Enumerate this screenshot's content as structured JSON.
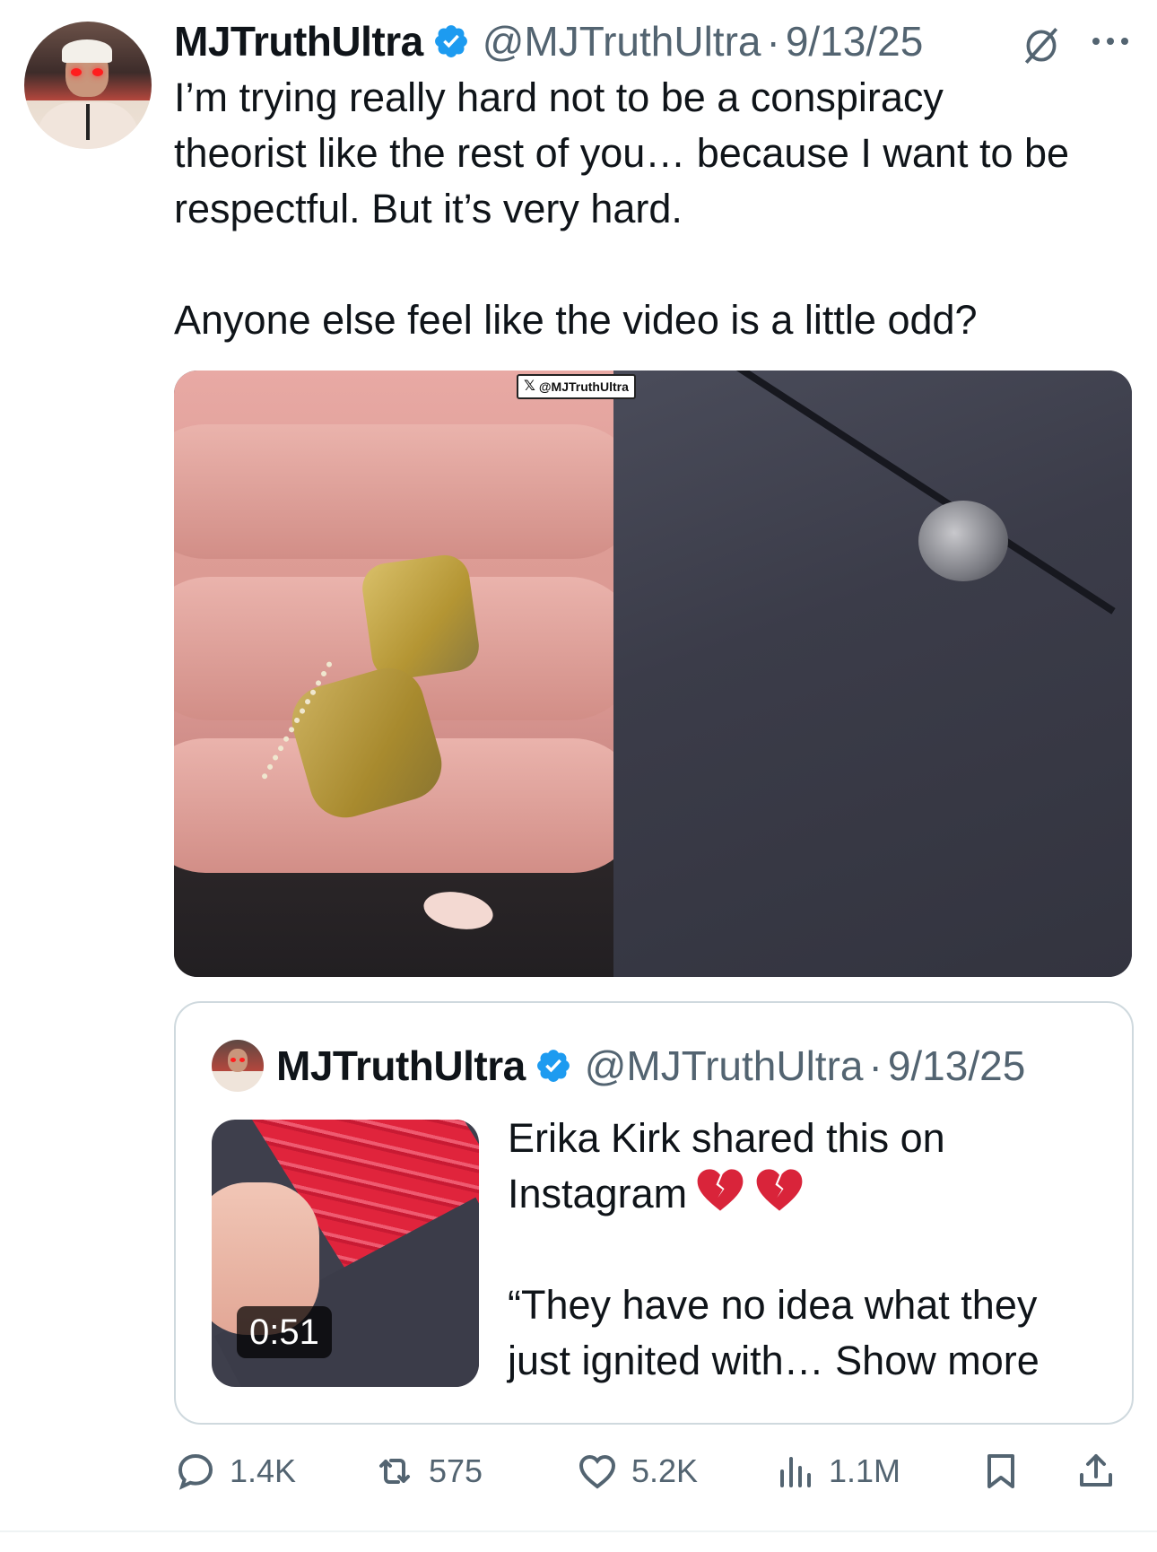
{
  "tweet": {
    "author_name": "MJTruthUltra",
    "handle": "@MJTruthUltra",
    "separator": "·",
    "date": "9/13/25",
    "text": "I’m trying really hard not to be a conspiracy\ntheorist like the rest of you… because I want to be\nrespectful. But it’s very hard.\n\nAnyone else feel like the video is a little odd?",
    "media_watermark": "@MJTruthUltra"
  },
  "quoted": {
    "author_name": "MJTruthUltra",
    "handle": "@MJTruthUltra",
    "separator": "·",
    "date": "9/13/25",
    "text_line1": "Erika Kirk shared this on\nInstagram",
    "emoji": "💔💔",
    "text_line2": "“They have no idea what they\njust ignited with… ",
    "show_more": "Show more",
    "video_duration": "0:51"
  },
  "actions": {
    "replies": "1.4K",
    "reposts": "575",
    "likes": "5.2K",
    "views": "1.1M"
  },
  "colors": {
    "text": "#0f1419",
    "secondary": "#536471",
    "verified": "#1d9bf0",
    "border": "#cfd9de",
    "heartbreak": "#d9243a"
  },
  "icons": [
    "verified-badge-icon",
    "grok-icon",
    "more-icon",
    "reply-icon",
    "repost-icon",
    "like-icon",
    "views-icon",
    "bookmark-icon",
    "share-icon",
    "x-logo-icon"
  ]
}
